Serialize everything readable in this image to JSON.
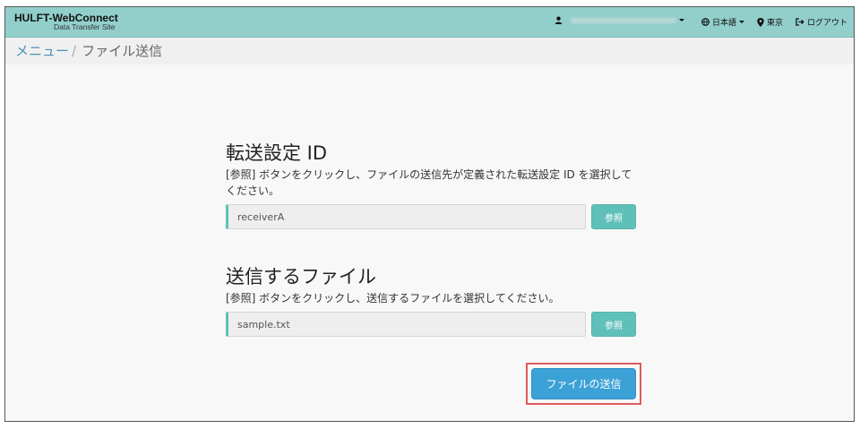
{
  "header": {
    "brand_main": "HULFT-WebConnect",
    "brand_sub": "Data Transfer Site",
    "user_icon": "user-icon",
    "language": "日本語",
    "region": "東京",
    "logout": "ログアウト"
  },
  "breadcrumb": {
    "menu": "メニュー",
    "separator": "/",
    "current": "ファイル送信"
  },
  "transfer_setting": {
    "title": "転送設定 ID",
    "description": "[参照] ボタンをクリックし、ファイルの送信先が定義された転送設定 ID を選択してください。",
    "value": "receiverA",
    "browse_label": "参照"
  },
  "send_file": {
    "title": "送信するファイル",
    "description": "[参照] ボタンをクリックし、送信するファイルを選択してください。",
    "value": "sample.txt",
    "browse_label": "参照"
  },
  "actions": {
    "send_label": "ファイルの送信"
  },
  "colors": {
    "navbar": "#92cfcb",
    "accent": "#5fc0b9",
    "primary_button": "#3ca1d6",
    "highlight": "#e05a5a"
  }
}
